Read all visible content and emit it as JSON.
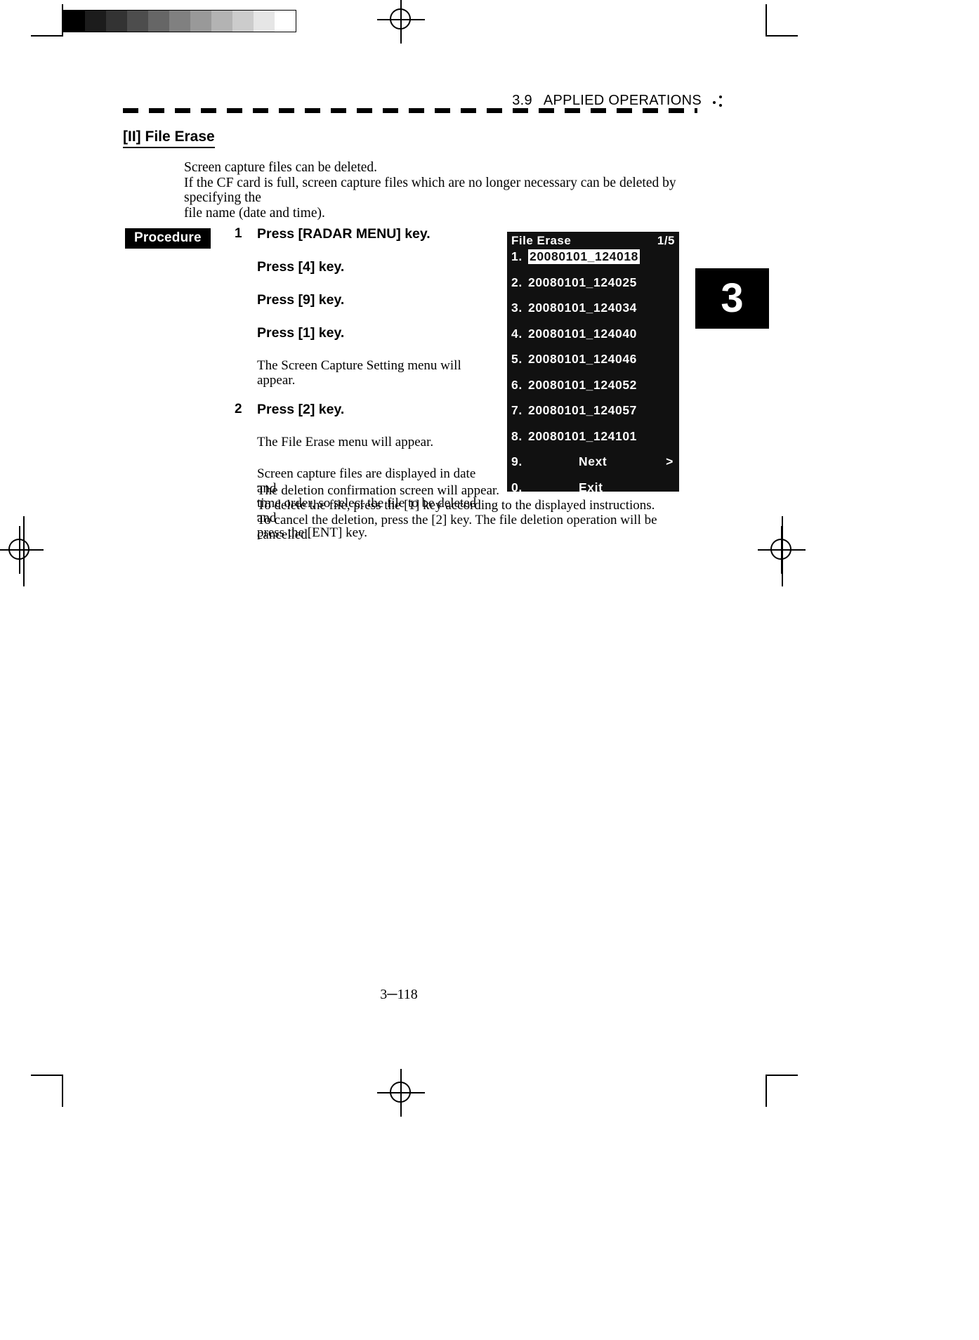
{
  "header": {
    "section_number": "3.9",
    "section_title": "APPLIED OPERATIONS",
    "dots_icon": "four-dots-icon"
  },
  "chapter_tab": {
    "number": "3"
  },
  "page_title": "[II] File Erase",
  "intro": [
    "Screen capture files can be deleted.",
    "If the CF card is full, screen capture files which are no longer necessary can be deleted by specifying the",
    "file name (date and time)."
  ],
  "procedure": {
    "badge": "Procedure",
    "steps": [
      {
        "num": "1",
        "text": "Press [RADAR MENU] key."
      },
      {
        "num": "",
        "text": "Press [4] key."
      },
      {
        "num": "",
        "text": "Press [9] key."
      },
      {
        "num": "",
        "text": "Press [1] key."
      }
    ],
    "note1": "The Screen Capture Setting menu will appear.",
    "step2": {
      "num": "2",
      "text": "Press [2] key."
    },
    "note2": "The File Erase menu will appear.",
    "note3": [
      "Screen capture files are displayed in date and",
      "time order, so select the file to be deleted and",
      "press the [ENT] key."
    ]
  },
  "tail": [
    "The deletion confirmation screen will appear.",
    "To delete the file, press the [1] key according to the displayed instructions.",
    "To cancel the deletion, press the [2] key.    The file deletion operation will be cancelled."
  ],
  "lcd": {
    "title": "File  Erase",
    "page_indicator": "1/5",
    "rows": [
      {
        "index": "1.",
        "name": "20080101_124018",
        "selected": true
      },
      {
        "index": "2.",
        "name": "20080101_124025",
        "selected": false
      },
      {
        "index": "3.",
        "name": "20080101_124034",
        "selected": false
      },
      {
        "index": "4.",
        "name": "20080101_124040",
        "selected": false
      },
      {
        "index": "5.",
        "name": "20080101_124046",
        "selected": false
      },
      {
        "index": "6.",
        "name": "20080101_124052",
        "selected": false
      },
      {
        "index": "7.",
        "name": "20080101_124057",
        "selected": false
      },
      {
        "index": "8.",
        "name": "20080101_124101",
        "selected": false
      }
    ],
    "next_row": {
      "index": "9.",
      "label": "Next",
      "arrow": ">"
    },
    "exit_row": {
      "index": "0.",
      "label": "Exit"
    }
  },
  "footer": {
    "page_number": "3─118"
  },
  "greyscale_steps": [
    "#000000",
    "#1c1c1c",
    "#333333",
    "#4d4d4d",
    "#666666",
    "#808080",
    "#999999",
    "#b3b3b3",
    "#cccccc",
    "#e6e6e6",
    "#ffffff"
  ]
}
